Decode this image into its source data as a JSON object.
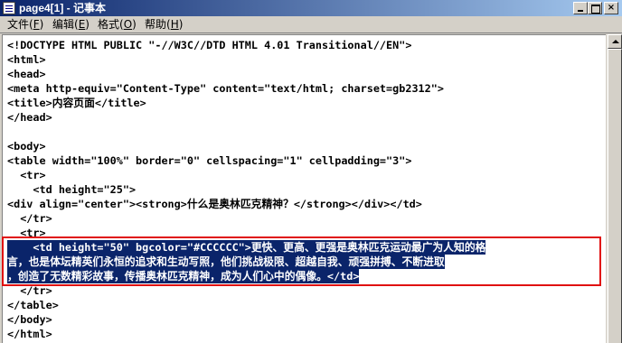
{
  "window": {
    "title": "page4[1] - 记事本",
    "controls": {
      "minimize": "",
      "maximize": "",
      "close": "×"
    }
  },
  "menu": {
    "items": [
      {
        "label": "文件(",
        "mnemonic": "F",
        "close": ")"
      },
      {
        "label": "编辑(",
        "mnemonic": "E",
        "close": ")"
      },
      {
        "label": "格式(",
        "mnemonic": "O",
        "close": ")"
      },
      {
        "label": "帮助(",
        "mnemonic": "H",
        "close": ")"
      }
    ]
  },
  "editor": {
    "lines": [
      "<!DOCTYPE HTML PUBLIC \"-//W3C//DTD HTML 4.01 Transitional//EN\">",
      "<html>",
      "<head>",
      "<meta http-equiv=\"Content-Type\" content=\"text/html; charset=gb2312\">",
      "<title>内容页面</title>",
      "</head>",
      "",
      "<body>",
      "<table width=\"100%\" border=\"0\" cellspacing=\"1\" cellpadding=\"3\">",
      "  <tr>",
      "    <td height=\"25\">",
      "<div align=\"center\"><strong>什么是奥林匹克精神？</strong></div></td>",
      "  </tr>",
      "  <tr>",
      "    <td height=\"50\" bgcolor=\"#CCCCCC\">更快、更高、更强是奥林匹克运动最广为人知的格",
      "言，也是体坛精英们永恒的追求和生动写照，他们挑战极限、超越自我、顽强拼搏、不断进取",
      "，创造了无数精彩故事，传播奥林匹克精神，成为人们心中的偶像。</td>",
      "  </tr>",
      "</table>",
      "</body>",
      "</html>"
    ]
  },
  "colors": {
    "selection": "#0a246a",
    "highlight_border": "#e01010"
  }
}
